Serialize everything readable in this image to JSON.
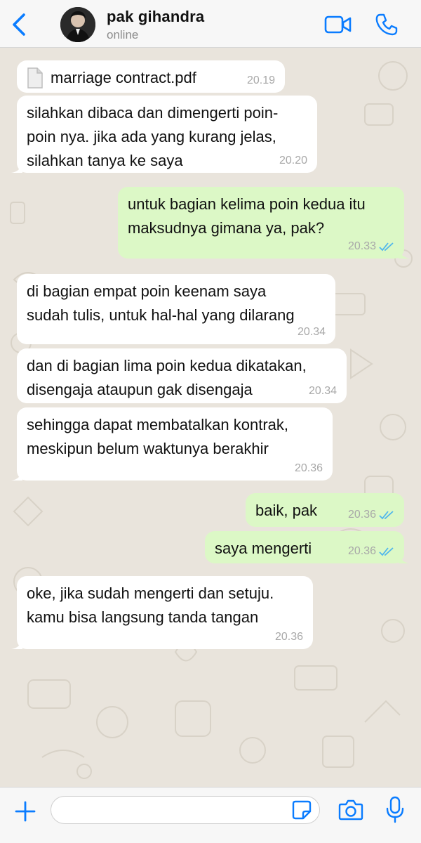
{
  "header": {
    "contact_name": "pak gihandra",
    "status": "online"
  },
  "colors": {
    "accent": "#0a7cff",
    "incoming_bubble": "#ffffff",
    "outgoing_bubble": "#dcf8c6",
    "wallpaper": "#e9e4dc",
    "read_ticks": "#4fb6ec"
  },
  "messages": [
    {
      "direction": "in",
      "type": "file",
      "file_name": "marriage contract.pdf",
      "time": "20.19"
    },
    {
      "direction": "in",
      "text": "silahkan dibaca dan dimengerti poin-\npoin nya. jika ada yang kurang jelas,\nsilahkan tanya ke saya",
      "time": "20.20"
    },
    {
      "direction": "out",
      "text": "untuk bagian kelima poin kedua itu\nmaksudnya gimana ya, pak?",
      "time": "20.33",
      "status": "read"
    },
    {
      "direction": "in",
      "text": "di bagian empat poin keenam saya\nsudah tulis, untuk hal-hal yang dilarang",
      "time": "20.34"
    },
    {
      "direction": "in",
      "text": "dan di bagian lima poin kedua dikatakan,\ndisengaja ataupun gak disengaja",
      "time": "20.34"
    },
    {
      "direction": "in",
      "text": "sehingga dapat membatalkan kontrak,\nmeskipun belum waktunya berakhir",
      "time": "20.36"
    },
    {
      "direction": "out",
      "text": "baik, pak",
      "time": "20.36",
      "status": "read"
    },
    {
      "direction": "out",
      "text": "saya mengerti",
      "time": "20.36",
      "status": "read"
    },
    {
      "direction": "in",
      "text": "oke, jika sudah mengerti dan setuju.\nkamu bisa langsung tanda tangan",
      "time": "20.36"
    }
  ],
  "input": {
    "value": "",
    "placeholder": ""
  },
  "icons": {
    "back": "chevron-left-icon",
    "video": "video-camera-icon",
    "call": "phone-icon",
    "plus": "plus-icon",
    "sticker": "sticker-icon",
    "camera": "camera-icon",
    "mic": "microphone-icon"
  }
}
